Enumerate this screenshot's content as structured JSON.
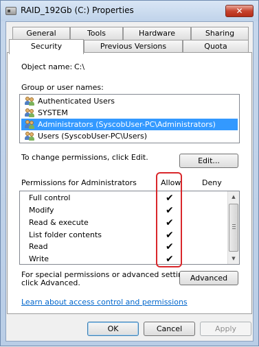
{
  "window": {
    "title": "RAID_192Gb (C:) Properties",
    "close_glyph": "✕"
  },
  "tabs_row1": [
    "General",
    "Tools",
    "Hardware",
    "Sharing"
  ],
  "tabs_row2": [
    "Security",
    "Previous Versions",
    "Quota"
  ],
  "selected_tab": "Security",
  "object": {
    "label": "Object name:",
    "value": "C:\\"
  },
  "groups": {
    "label": "Group or user names:",
    "users": [
      {
        "name": "Authenticated Users",
        "icon": "users-icon"
      },
      {
        "name": "SYSTEM",
        "icon": "users-icon"
      },
      {
        "name": "Administrators (SyscobUser-PC\\Administrators)",
        "icon": "users-icon",
        "selected": true
      },
      {
        "name": "Users (SyscobUser-PC\\Users)",
        "icon": "users-icon"
      }
    ]
  },
  "change_text": "To change permissions, click Edit.",
  "edit_button": "Edit...",
  "permissions": {
    "header": "Permissions for Administrators",
    "allow": "Allow",
    "deny": "Deny",
    "check_glyph": "✔",
    "rows": [
      {
        "name": "Full control",
        "allow": true,
        "deny": false
      },
      {
        "name": "Modify",
        "allow": true,
        "deny": false
      },
      {
        "name": "Read & execute",
        "allow": true,
        "deny": false
      },
      {
        "name": "List folder contents",
        "allow": true,
        "deny": false
      },
      {
        "name": "Read",
        "allow": true,
        "deny": false
      },
      {
        "name": "Write",
        "allow": true,
        "deny": false
      }
    ]
  },
  "advanced": {
    "line1": "For special permissions or advanced settings,",
    "line2": "click Advanced.",
    "button": "Advanced"
  },
  "learn_link": "Learn about access control and permissions",
  "footer": {
    "ok": "OK",
    "cancel": "Cancel",
    "apply": "Apply"
  },
  "colors": {
    "selection": "#3399ff",
    "highlight_box": "#d9262a",
    "link": "#0066cc"
  }
}
